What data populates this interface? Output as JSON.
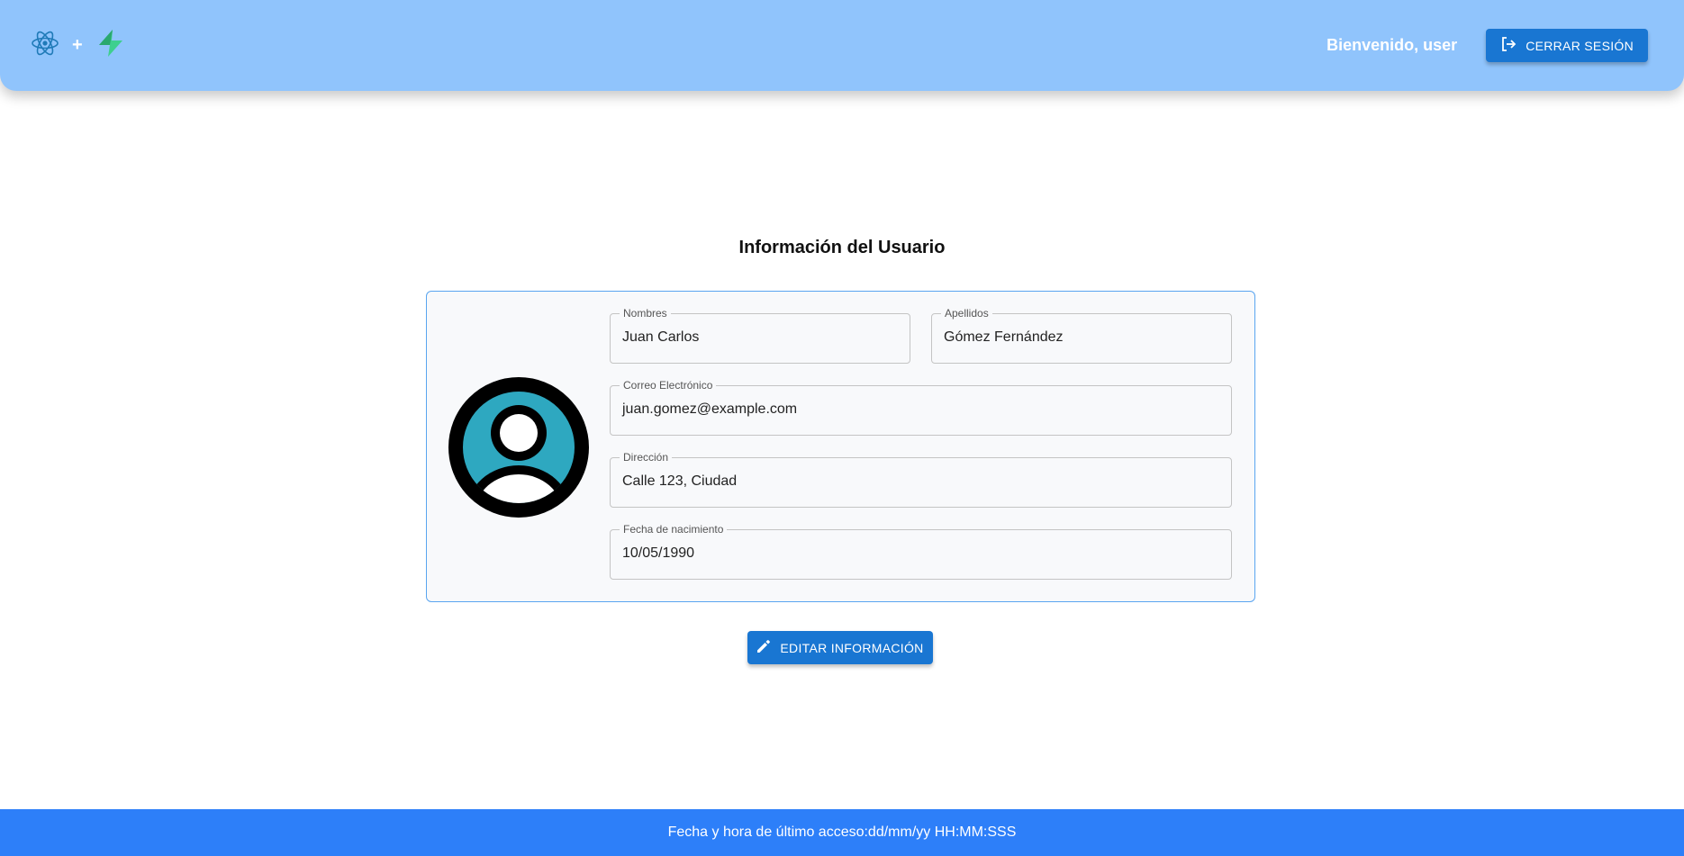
{
  "header": {
    "logo_separator": "+",
    "welcome_text": "Bienvenido, user",
    "logout_label": "CERRAR SESIÓN"
  },
  "main": {
    "title": "Información del Usuario",
    "fields": {
      "nombres": {
        "label": "Nombres",
        "value": "Juan Carlos"
      },
      "apellidos": {
        "label": "Apellidos",
        "value": "Gómez Fernández"
      },
      "correo": {
        "label": "Correo Electrónico",
        "value": "juan.gomez@example.com"
      },
      "direccion": {
        "label": "Dirección",
        "value": "Calle 123, Ciudad"
      },
      "fecha": {
        "label": "Fecha de nacimiento",
        "value": "10/05/1990"
      }
    },
    "edit_label": "EDITAR INFORMACIÓN"
  },
  "footer": {
    "last_access": "Fecha y hora de último acceso:dd/mm/yy HH:MM:SSS"
  },
  "icons": {
    "react_logo": "react-icon",
    "supabase_logo": "supabase-icon",
    "logout": "logout-icon",
    "avatar": "user-avatar-icon",
    "edit": "pencil-icon"
  },
  "colors": {
    "appbar": "#90c4fc",
    "primary_button": "#1976d2",
    "footer": "#2d7ff9",
    "card_border": "#5aa5f0",
    "avatar_fill": "#2ea8c0"
  }
}
